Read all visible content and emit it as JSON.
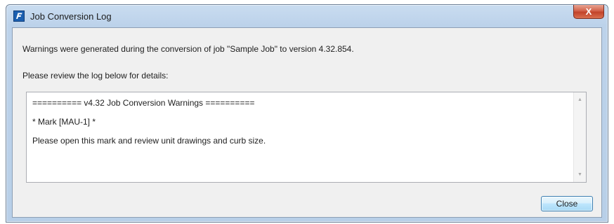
{
  "window": {
    "title": "Job Conversion Log",
    "close_glyph": "X"
  },
  "messages": {
    "warning": "Warnings were generated during the conversion of job \"Sample Job\" to version 4.32.854.",
    "review": "Please review the log below for details:"
  },
  "log": {
    "lines": [
      "========== v4.32 Job Conversion Warnings ==========",
      "* Mark [MAU-1] *",
      "Please open this mark and review unit drawings and curb size."
    ]
  },
  "buttons": {
    "close_label": "Close"
  },
  "icons": {
    "app": "app-logo-icon",
    "scroll_up": "scroll-up-arrow-icon",
    "scroll_down": "scroll-down-arrow-icon"
  },
  "colors": {
    "titlebar": "#bcd2ea",
    "close_x": "#c2432a",
    "button_border": "#3c7fb1",
    "client_bg": "#f0f0f0"
  }
}
